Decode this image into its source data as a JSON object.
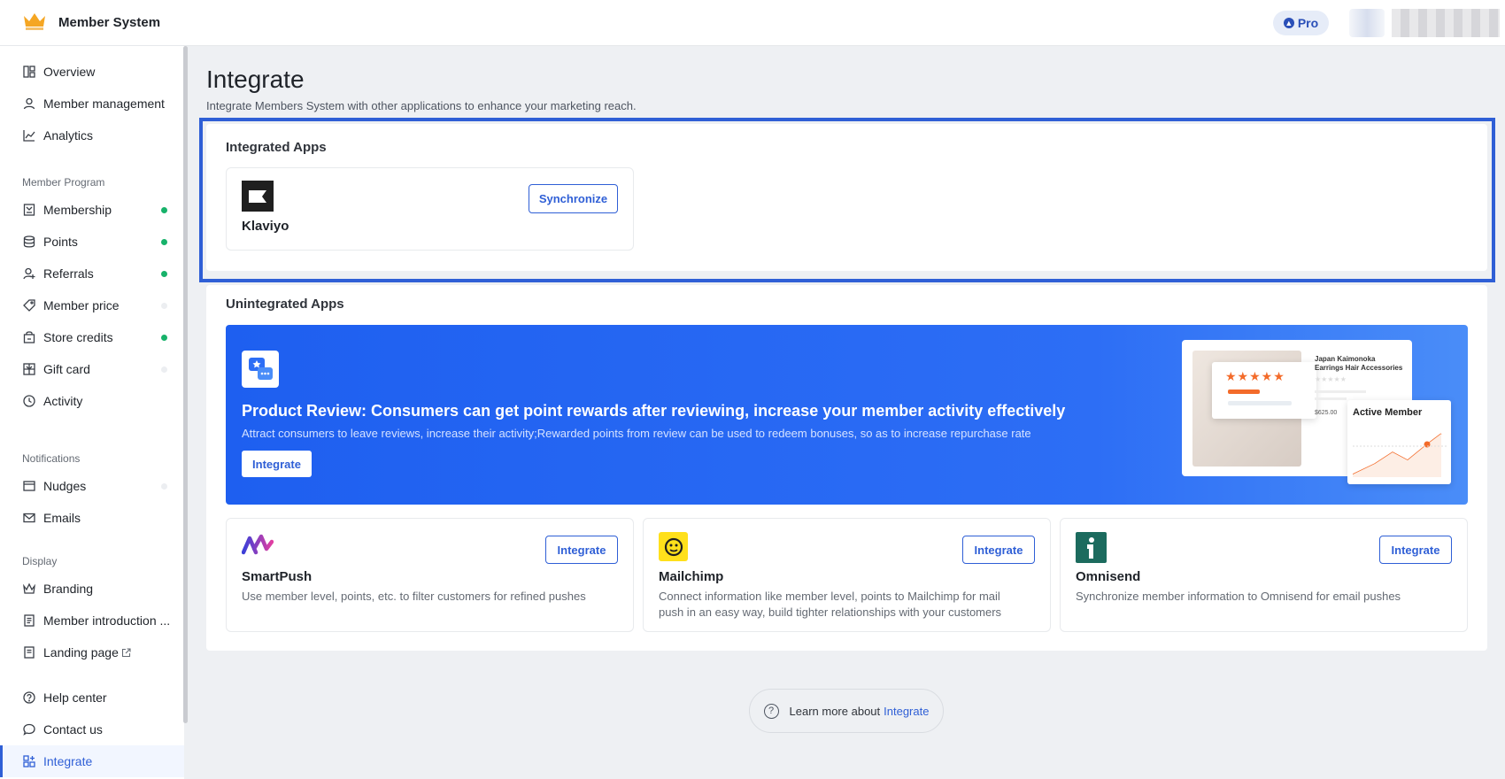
{
  "header": {
    "title": "Member System",
    "pro_label": "Pro"
  },
  "sidebar": {
    "items": [
      {
        "label": "Overview",
        "icon": "dashboard-icon"
      },
      {
        "label": "Member management",
        "icon": "user-icon"
      },
      {
        "label": "Analytics",
        "icon": "chart-icon"
      }
    ],
    "program_group": "Member Program",
    "program_items": [
      {
        "label": "Membership",
        "icon": "membership-icon",
        "status": "active"
      },
      {
        "label": "Points",
        "icon": "coins-icon",
        "status": "active"
      },
      {
        "label": "Referrals",
        "icon": "referral-icon",
        "status": "active"
      },
      {
        "label": "Member price",
        "icon": "tag-icon",
        "status": "inactive"
      },
      {
        "label": "Store credits",
        "icon": "store-credit-icon",
        "status": "active"
      },
      {
        "label": "Gift card",
        "icon": "gift-card-icon",
        "status": "inactive"
      },
      {
        "label": "Activity",
        "icon": "clock-icon"
      }
    ],
    "notifications_group": "Notifications",
    "notification_items": [
      {
        "label": "Nudges",
        "icon": "nudge-icon",
        "status": "inactive"
      },
      {
        "label": "Emails",
        "icon": "mail-icon"
      }
    ],
    "display_group": "Display",
    "display_items": [
      {
        "label": "Branding",
        "icon": "crown-outline-icon"
      },
      {
        "label": "Member introduction ...",
        "icon": "document-icon"
      },
      {
        "label": "Landing page",
        "icon": "page-icon"
      }
    ],
    "bottom_items": [
      {
        "label": "Help center",
        "icon": "help-icon"
      },
      {
        "label": "Contact us",
        "icon": "chat-icon"
      },
      {
        "label": "Integrate",
        "icon": "integrate-icon",
        "active": true
      }
    ]
  },
  "page": {
    "title": "Integrate",
    "subtitle": "Integrate Members System with other applications to enhance your marketing reach."
  },
  "integrated": {
    "section_title": "Integrated Apps",
    "apps": [
      {
        "name": "Klaviyo",
        "button": "Synchronize",
        "icon": "klaviyo-logo-icon"
      }
    ]
  },
  "unintegrated": {
    "section_title": "Unintegrated Apps",
    "banner": {
      "title": "Product Review: Consumers can get point rewards after reviewing, increase your member activity effectively",
      "description": "Attract consumers to leave reviews, increase their activity;Rewarded points from review can be used to redeem bonuses, so as to increase repurchase rate",
      "button": "Integrate",
      "preview_product": "Japan Kaimonoka Earrings Hair Accessories",
      "preview_price": "$625.00",
      "preview_card_title": "Active Member"
    },
    "apps": [
      {
        "name": "SmartPush",
        "button": "Integrate",
        "icon": "smartpush-logo-icon",
        "description": "Use member level, points, etc. to filter customers for refined pushes"
      },
      {
        "name": "Mailchimp",
        "button": "Integrate",
        "icon": "mailchimp-logo-icon",
        "description": "Connect information like member level, points to Mailchimp for mail push in an easy way, build tighter relationships with your customers"
      },
      {
        "name": "Omnisend",
        "button": "Integrate",
        "icon": "omnisend-logo-icon",
        "description": "Synchronize member information to Omnisend for email pushes"
      }
    ]
  },
  "footer": {
    "learn_text": "Learn more about",
    "learn_link": "Integrate"
  },
  "colors": {
    "accent": "#2f5fd6",
    "status_active": "#17b26a",
    "status_inactive": "#e8eaed",
    "banner": "#1e5ff0"
  }
}
